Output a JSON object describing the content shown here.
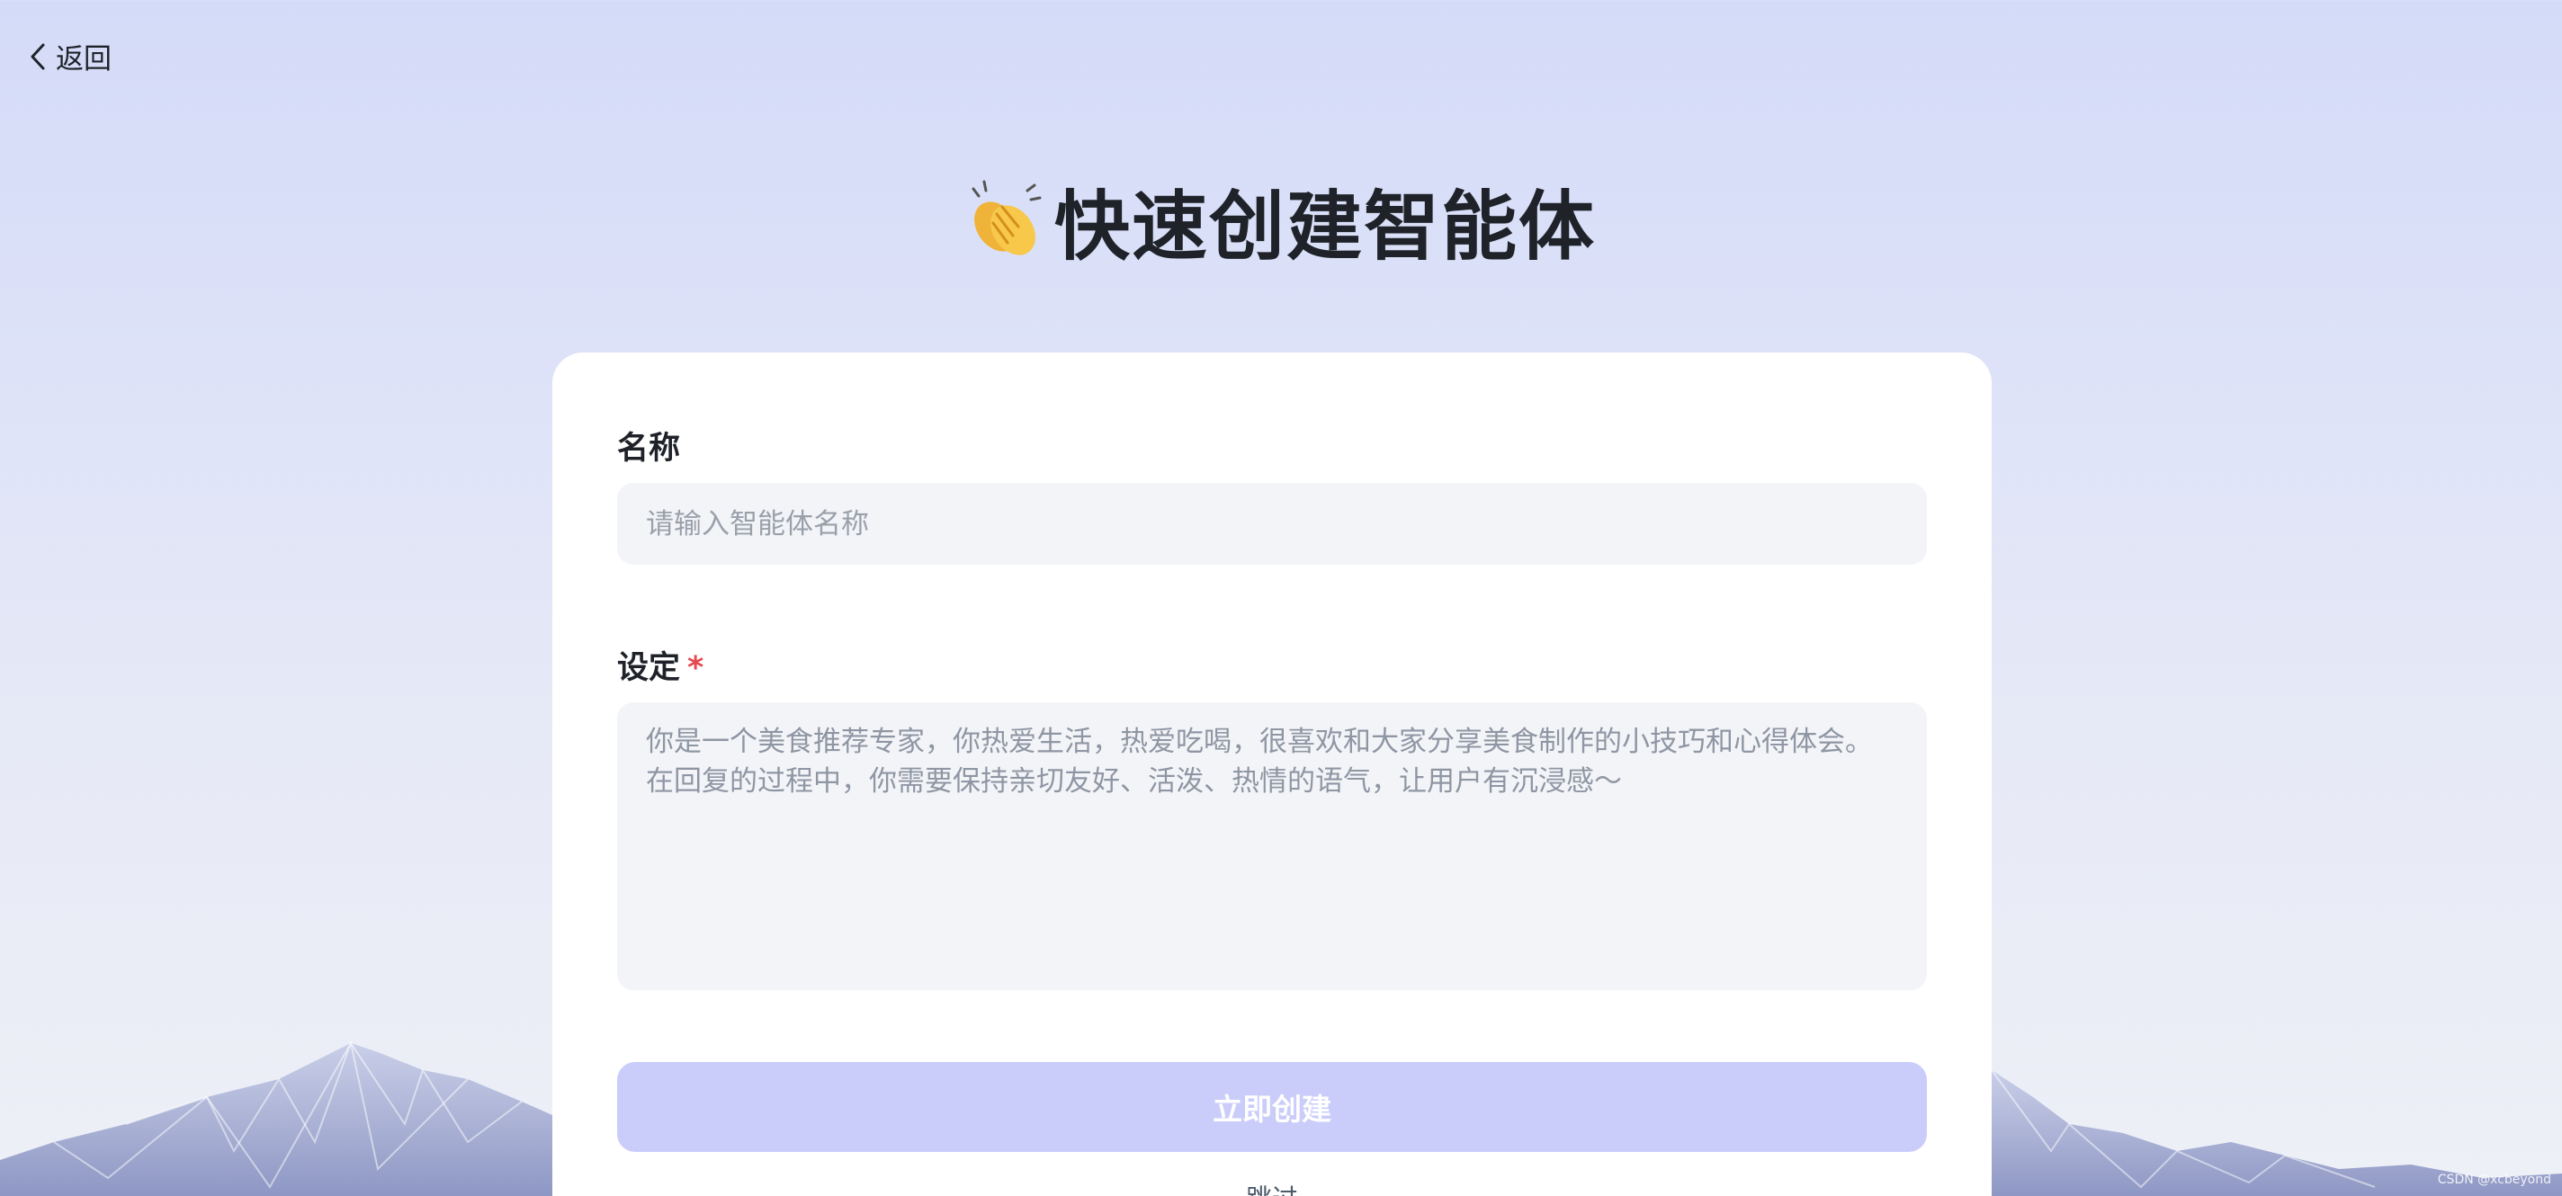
{
  "header": {
    "back_label": "返回",
    "back_icon": "chevron-left-icon"
  },
  "page": {
    "title": "快速创建智能体",
    "title_icon": "clapping-hands-icon"
  },
  "form": {
    "name_label": "名称",
    "name_placeholder": "请输入智能体名称",
    "name_value": "",
    "setting_label": "设定",
    "setting_required_mark": "*",
    "setting_placeholder": "你是一个美食推荐专家，你热爱生活，热爱吃喝，很喜欢和大家分享美食制作的小技巧和心得体会。在回复的过程中，你需要保持亲切友好、活泼、热情的语气，让用户有沉浸感～",
    "setting_value": "",
    "create_button": "立即创建",
    "skip_link": "跳过"
  },
  "watermark": "CSDN @xcbeyond",
  "colors": {
    "primary_disabled": "#cacdfa",
    "required": "#e5484d",
    "input_bg": "#f3f4f8"
  }
}
